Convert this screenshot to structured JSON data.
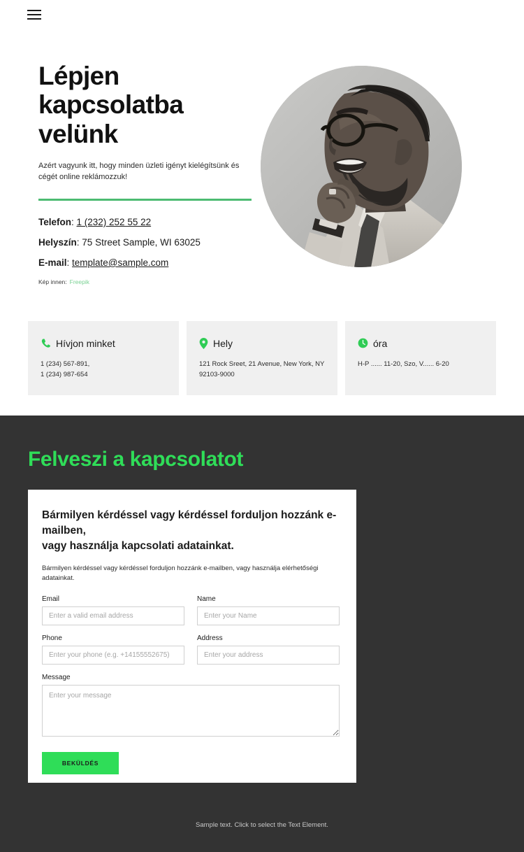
{
  "header": {
    "menu_icon": "hamburger-menu-icon"
  },
  "hero": {
    "title": "Lépjen kapcsolatba velünk",
    "subtitle": "Azért vagyunk itt, hogy minden üzleti igényt kielégítsünk és cégét online reklámozzuk!",
    "contacts": [
      {
        "label": "Telefon",
        "sep": ": ",
        "value": "1 (232) 252 55 22",
        "link": true
      },
      {
        "label": "Helyszín",
        "sep": ": ",
        "value": "75 Street Sample, WI 63025",
        "link": false
      },
      {
        "label": "E-mail",
        "sep": ": ",
        "value": "template@sample.com",
        "link": true
      }
    ],
    "credit_label": "Kép innen:",
    "credit_link": "Freepik",
    "photo_alt": "portrait-photo"
  },
  "cards": [
    {
      "icon": "phone-icon",
      "title": "Hívjon minket",
      "body": "1 (234) 567-891,\n1 (234) 987-654"
    },
    {
      "icon": "location-pin-icon",
      "title": "Hely",
      "body": "121 Rock Sreet, 21 Avenue, New York, NY 92103-9000"
    },
    {
      "icon": "clock-icon",
      "title": "óra",
      "body": "H-P ...... 11-20, Szo, V...... 6-20"
    }
  ],
  "contact_section": {
    "title": "Felveszi a kapcsolatot",
    "form_heading": "Bármilyen kérdéssel vagy kérdéssel forduljon hozzánk e-mailben,\nvagy használja kapcsolati adatainkat.",
    "form_intro": "Bármilyen kérdéssel vagy kérdéssel forduljon hozzánk e-mailben, vagy használja elérhetőségi adatainkat.",
    "fields": {
      "email": {
        "label": "Email",
        "placeholder": "Enter a valid email address",
        "value": ""
      },
      "name": {
        "label": "Name",
        "placeholder": "Enter your Name",
        "value": ""
      },
      "phone": {
        "label": "Phone",
        "placeholder": "Enter your phone (e.g. +14155552675)",
        "value": ""
      },
      "address": {
        "label": "Address",
        "placeholder": "Enter your address",
        "value": ""
      },
      "message": {
        "label": "Message",
        "placeholder": "Enter your message",
        "value": ""
      }
    },
    "submit_label": "BEKÜLDÉS"
  },
  "footer": {
    "note": "Sample text. Click to select the Text Element."
  },
  "colors": {
    "accent_green": "#2fdd58",
    "rule_green": "#4cbb71",
    "icon_green": "#2fcc55",
    "dark_bg": "#333333",
    "card_bg": "#f0f0f0"
  }
}
